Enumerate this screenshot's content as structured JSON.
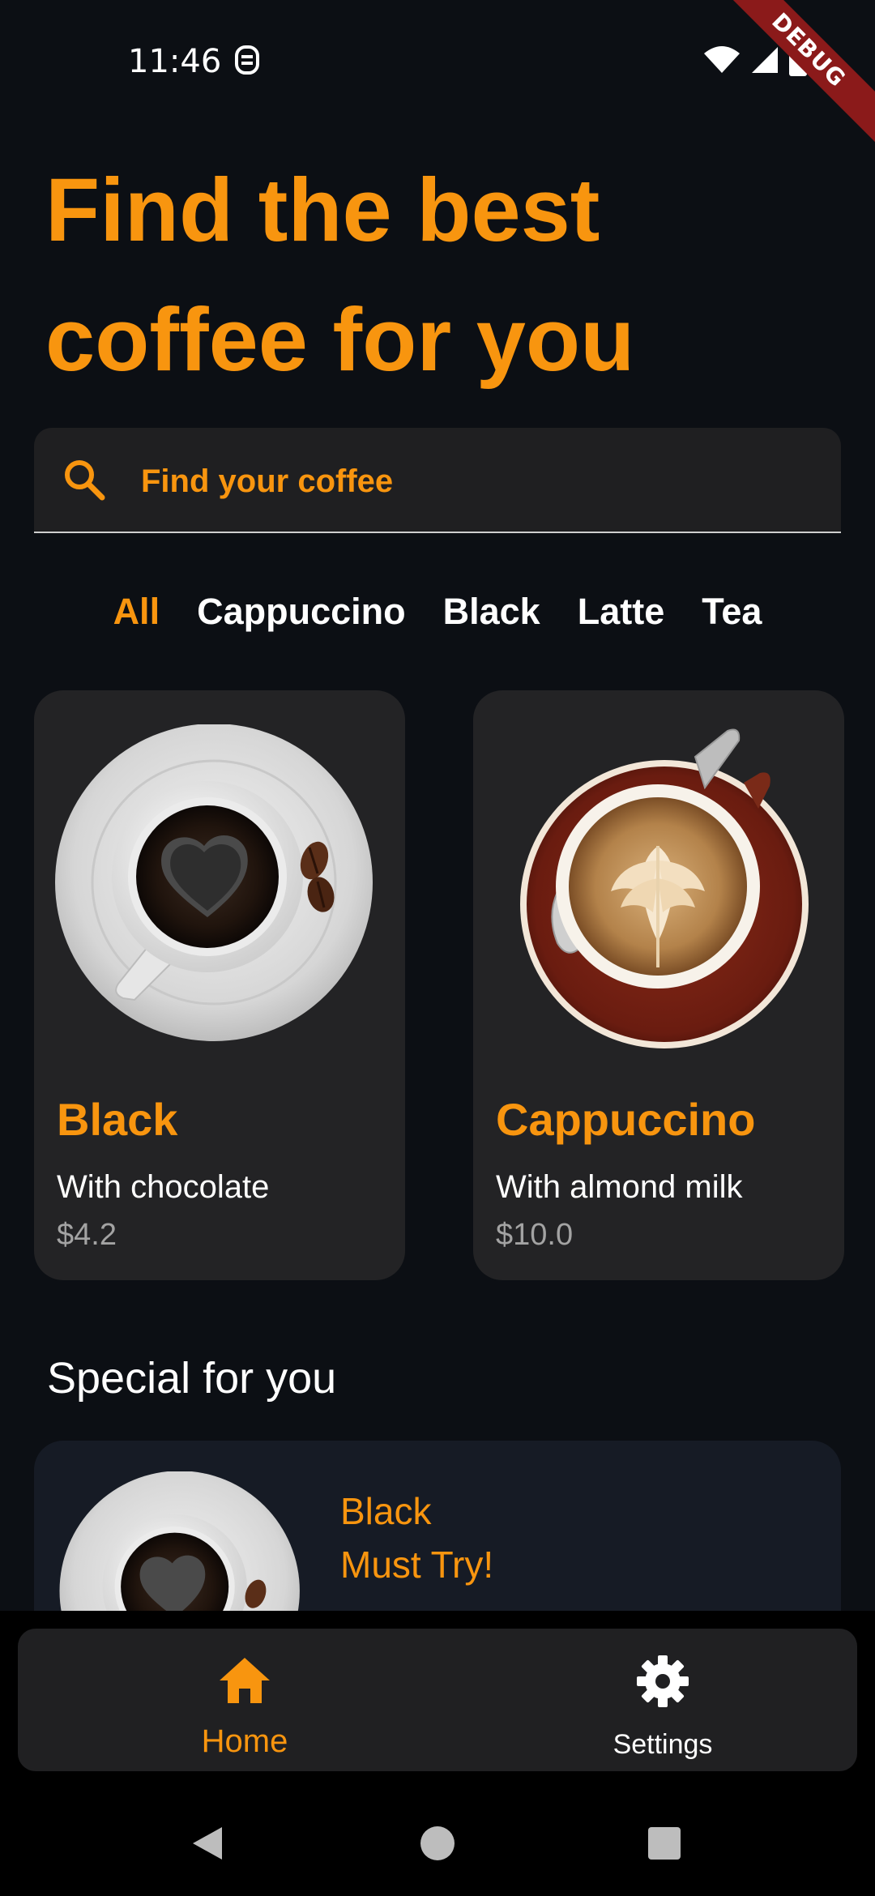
{
  "status_bar": {
    "time": "11:46",
    "debug_label": "DEBUG",
    "icons": [
      "app-notification-icon",
      "wifi-icon",
      "cellular-signal-icon",
      "battery-icon"
    ]
  },
  "headline": {
    "line1": "Find the best",
    "line2": "coffee for you"
  },
  "search": {
    "placeholder": "Find your coffee",
    "icon": "search-icon"
  },
  "categories": {
    "items": [
      "All",
      "Cappuccino",
      "Black",
      "Latte",
      "Tea"
    ],
    "active": "All"
  },
  "coffees": [
    {
      "name": "Black",
      "description": "With chocolate",
      "price": "$4.2",
      "image": "black-coffee-heart-cup"
    },
    {
      "name": "Cappuccino",
      "description": "With almond milk",
      "price": "$10.0",
      "image": "cappuccino-latte-art-cup"
    }
  ],
  "special": {
    "title": "Special for you",
    "item_name": "Black",
    "tagline": "Must Try!",
    "image": "black-coffee-heart-cup"
  },
  "bottom_nav": {
    "items": [
      {
        "label": "Home",
        "icon": "home-icon",
        "active": true
      },
      {
        "label": "Settings",
        "icon": "gear-icon",
        "active": false
      }
    ]
  },
  "system_nav": {
    "icons": [
      "back-icon",
      "home-circle-icon",
      "recents-icon"
    ]
  },
  "colors": {
    "background": "#0c0f14",
    "accent": "#f8950f",
    "card": "#232325",
    "special_card": "#161b25",
    "nav_bar": "#202022",
    "price_text": "#a3a3a3",
    "debug_banner": "#8b1a1a"
  }
}
